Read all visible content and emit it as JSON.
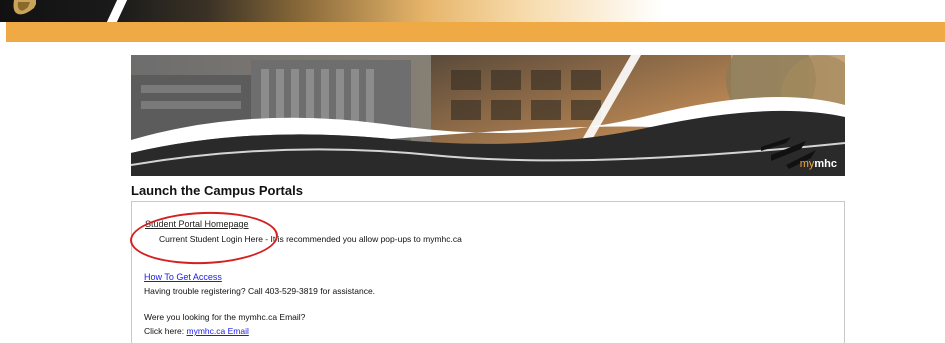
{
  "colors": {
    "accent_orange": "#f0aa45",
    "link_blue": "#1a1aee",
    "annotation_red": "#d42020"
  },
  "banner": {
    "brand_prefix": "my",
    "brand_suffix": "mhc"
  },
  "section": {
    "title": "Launch the Campus Portals"
  },
  "portal": {
    "student_link": "Student Portal Homepage",
    "student_desc": "Current Student Login Here - It is recommended you allow pop-ups to mymhc.ca",
    "access_link": "How To Get Access",
    "access_desc": "Having trouble registering? Call 403-529-3819 for assistance.",
    "email_question": "Were you looking for the mymhc.ca Email?",
    "email_prompt": "Click here: ",
    "email_link": "mymhc.ca Email"
  },
  "icons": [
    "shield-icon",
    "brand-logo-icon"
  ]
}
